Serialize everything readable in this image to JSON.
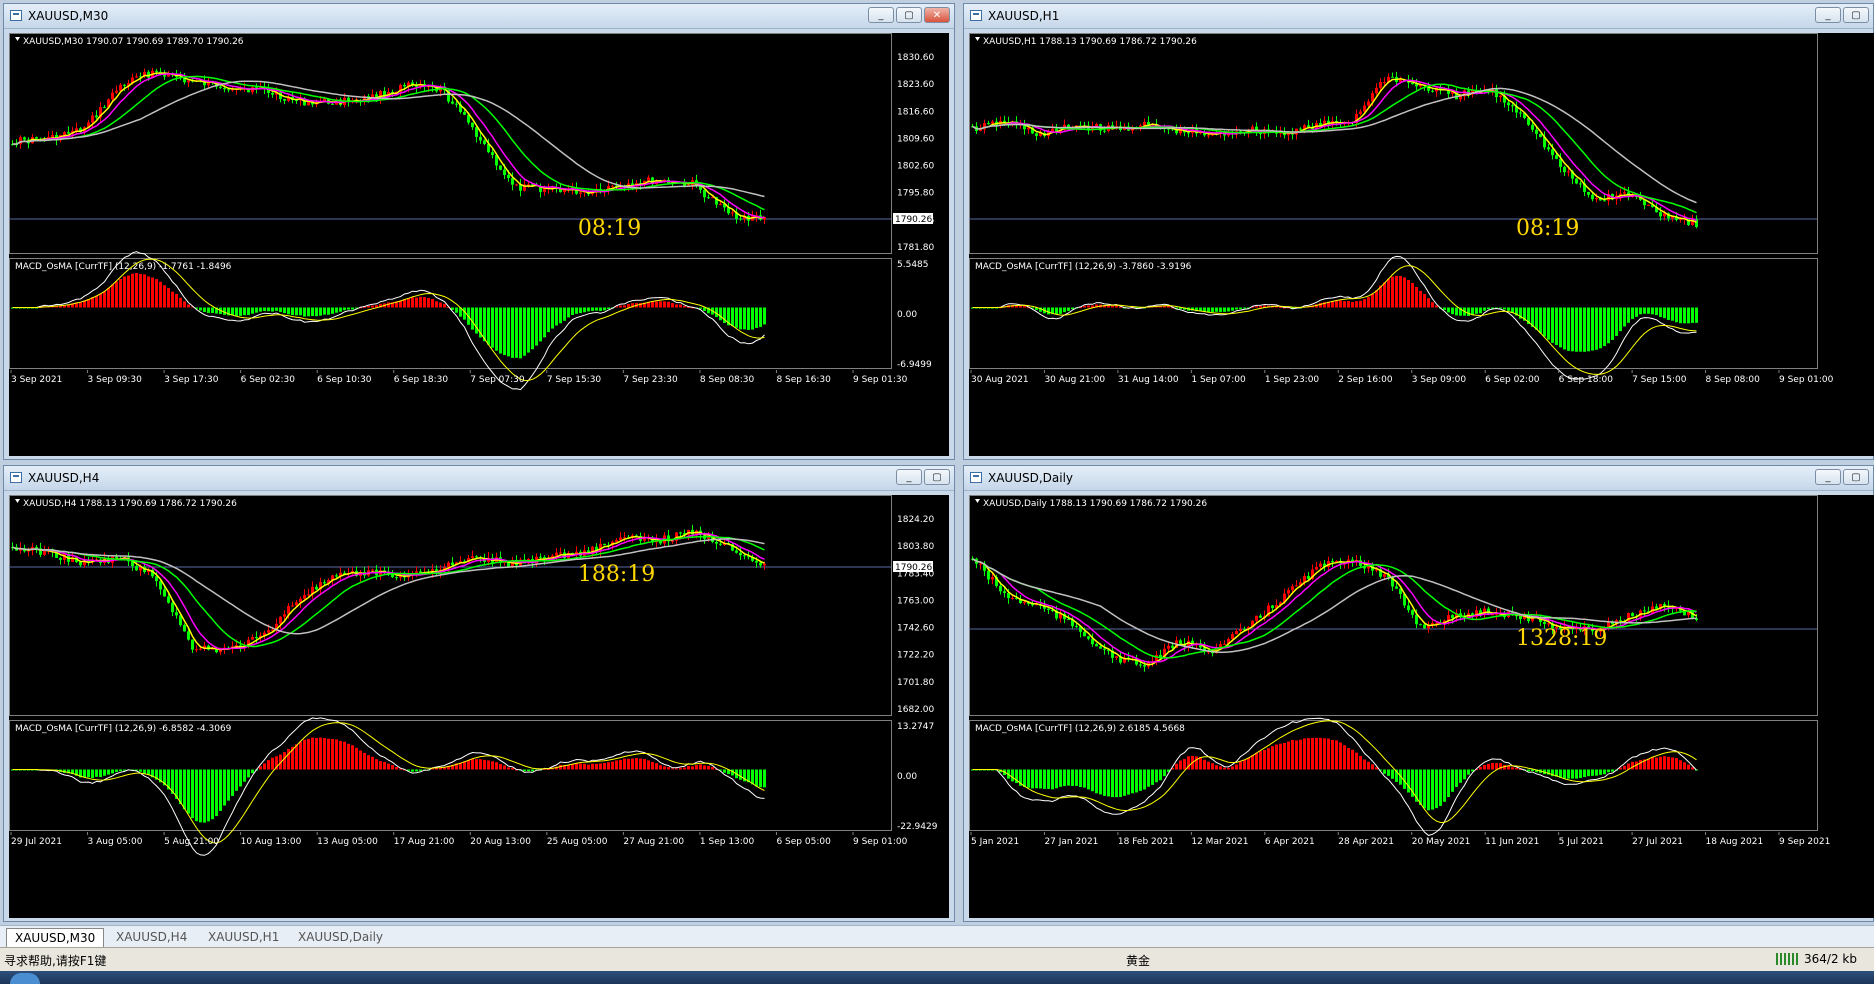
{
  "windows": [
    {
      "title": "XAUUSD,M30",
      "header": "XAUUSD,M30  1790.07 1790.69 1789.70 1790.26",
      "price_labels": [
        "1830.60",
        "1823.60",
        "1816.60",
        "1809.60",
        "1802.60",
        "1795.80",
        "1790.26",
        "1781.80"
      ],
      "current_price": "1790.26",
      "timer": "08:19",
      "macd_header": "MACD_OsMA [CurrTF] (12,26,9) -1.7761 -1.8496",
      "macd_labels": [
        "5.5485",
        "0.00",
        "-6.9499"
      ],
      "dates": [
        "3 Sep 2021",
        "3 Sep 09:30",
        "3 Sep 17:30",
        "6 Sep 02:30",
        "6 Sep 10:30",
        "6 Sep 18:30",
        "7 Sep 07:30",
        "7 Sep 15:30",
        "7 Sep 23:30",
        "8 Sep 08:30",
        "8 Sep 16:30",
        "9 Sep 01:30"
      ],
      "buttons": [
        "_",
        "▢",
        "✕"
      ]
    },
    {
      "title": "XAUUSD,H1",
      "header": "XAUUSD,H1  1788.13 1790.69 1786.72 1790.26",
      "price_labels": [
        "",
        "",
        "",
        "",
        "",
        "",
        "",
        ""
      ],
      "current_price": "",
      "timer": "08:19",
      "macd_header": "MACD_OsMA [CurrTF] (12,26,9) -3.7860 -3.9196",
      "macd_labels": [
        "",
        "",
        ""
      ],
      "dates": [
        "30 Aug 2021",
        "30 Aug 21:00",
        "31 Aug 14:00",
        "1 Sep 07:00",
        "1 Sep 23:00",
        "2 Sep 16:00",
        "3 Sep 09:00",
        "6 Sep 02:00",
        "6 Sep 18:00",
        "7 Sep 15:00",
        "8 Sep 08:00",
        "9 Sep 01:00"
      ],
      "buttons": [
        "_",
        "▢"
      ]
    },
    {
      "title": "XAUUSD,H4",
      "header": "XAUUSD,H4  1788.13 1790.69 1786.72 1790.26",
      "price_labels": [
        "1824.20",
        "1803.80",
        "1783.40",
        "1763.00",
        "1742.60",
        "1722.20",
        "1701.80",
        "1682.00"
      ],
      "current_price": "1790.26",
      "timer": "188:19",
      "macd_header": "MACD_OsMA [CurrTF] (12,26,9) -6.8582 -4.3069",
      "macd_labels": [
        "13.2747",
        "0.00",
        "-22.9429"
      ],
      "dates": [
        "29 Jul 2021",
        "3 Aug 05:00",
        "5 Aug 21:00",
        "10 Aug 13:00",
        "13 Aug 05:00",
        "17 Aug 21:00",
        "20 Aug 13:00",
        "25 Aug 05:00",
        "27 Aug 21:00",
        "1 Sep 13:00",
        "6 Sep 05:00",
        "9 Sep 01:00"
      ],
      "buttons": [
        "_",
        "▢"
      ]
    },
    {
      "title": "XAUUSD,Daily",
      "header": "XAUUSD,Daily  1788.13 1790.69 1786.72 1790.26",
      "price_labels": [
        "",
        "",
        "",
        "",
        "",
        "",
        "",
        ""
      ],
      "current_price": "",
      "timer": "1328:19",
      "macd_header": "MACD_OsMA [CurrTF] (12,26,9) 2.6185 4.5668",
      "macd_labels": [
        "",
        "",
        ""
      ],
      "dates": [
        "5 Jan 2021",
        "27 Jan 2021",
        "18 Feb 2021",
        "12 Mar 2021",
        "6 Apr 2021",
        "28 Apr 2021",
        "20 May 2021",
        "11 Jun 2021",
        "5 Jul 2021",
        "27 Jul 2021",
        "18 Aug 2021",
        "9 Sep 2021"
      ],
      "buttons": [
        "_",
        "▢"
      ]
    }
  ],
  "tabs": [
    "XAUUSD,M30",
    "XAUUSD,H4",
    "XAUUSD,H1",
    "XAUUSD,Daily"
  ],
  "status": {
    "help": "寻求帮助,请按F1键",
    "symbol": "黄金",
    "traffic": "364/2 kb"
  },
  "colors": {
    "bull": "#ff0000",
    "bear": "#00ff00",
    "ma1": "#ffff00",
    "ma2": "#ff00ff",
    "ma3": "#00ff00",
    "ma4": "#c0c0c0",
    "timer": "#ffd700",
    "bg": "#000000"
  }
}
